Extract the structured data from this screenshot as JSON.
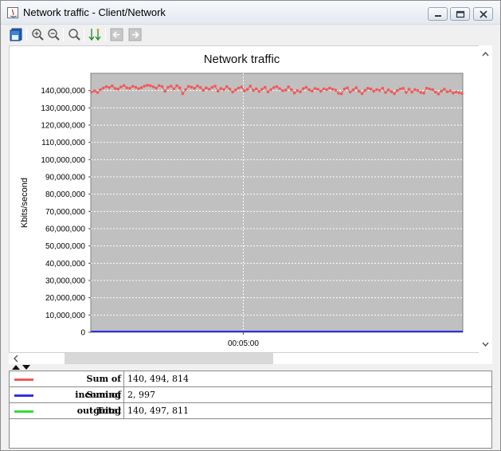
{
  "window": {
    "title": "Network traffic - Client/Network",
    "buttons": [
      "minimize",
      "maximize",
      "close"
    ]
  },
  "toolbar": {
    "items": [
      "save-icon",
      "zoom-in-icon",
      "zoom-out-icon",
      "zoom-fit-icon",
      "sort-down-icon",
      "back-icon",
      "forward-icon"
    ]
  },
  "chart_data": {
    "type": "scatter",
    "title": "Network traffic",
    "xlabel": "",
    "ylabel": "Kbits/second",
    "xticks": [
      "00:05:00"
    ],
    "yticks": [
      "0",
      "10,000,000",
      "20,000,000",
      "30,000,000",
      "40,000,000",
      "50,000,000",
      "60,000,000",
      "70,000,000",
      "80,000,000",
      "90,000,000",
      "100,000,000",
      "110,000,000",
      "120,000,000",
      "130,000,000",
      "140,000,000"
    ],
    "ylim": [
      0,
      150000000
    ],
    "grid": true,
    "colors": {
      "incoming": "#f05a5a",
      "outgoing": "#3030e0",
      "total": "#33dd33",
      "plot_bg": "#c0c0c0"
    },
    "series": [
      {
        "name": "Sum of incoming",
        "values": [
          139200000,
          139800000,
          138900000,
          140600000,
          141500000,
          142300000,
          141800000,
          142700000,
          141200000,
          140900000,
          142100000,
          142900000,
          141600000,
          141300000,
          142500000,
          141900000,
          141100000,
          141700000,
          142600000,
          143100000,
          142800000,
          142200000,
          141400000,
          142900000,
          142300000,
          139600000,
          141900000,
          142600000,
          141000000,
          142800000,
          141600000,
          138200000,
          140600000,
          142400000,
          142000000,
          141300000,
          142700000,
          141800000,
          140200000,
          141600000,
          140800000,
          141900000,
          142600000,
          139700000,
          141200000,
          140600000,
          142300000,
          140900000,
          139200000,
          140400000,
          141500000,
          142100000,
          139800000,
          140700000,
          142600000,
          140100000,
          141000000,
          139500000,
          140800000,
          141900000,
          139200000,
          140600000,
          141800000,
          142300000,
          141100000,
          139900000,
          140300000,
          142200000,
          140500000,
          138600000,
          140000000,
          139300000,
          141100000,
          141900000,
          140500000,
          139700000,
          141200000,
          140800000,
          139600000,
          141000000,
          140600000,
          141500000,
          140800000,
          140300000,
          138400000,
          138100000,
          140900000,
          141600000,
          139200000,
          140400000,
          141700000,
          139600000,
          138200000,
          140100000,
          141300000,
          140900000,
          139600000,
          140600000,
          140100000,
          141400000,
          138900000,
          140400000,
          139400000,
          138200000,
          140000000,
          140900000,
          141300000,
          138900000,
          140800000,
          139200000,
          140600000,
          140000000,
          138900000,
          138500000,
          141400000,
          140900000,
          140600000,
          139100000,
          138000000,
          139700000,
          140800000,
          139300000,
          139900000,
          138600000,
          139200000,
          138800000,
          138300000
        ]
      },
      {
        "name": "Sum of outgoing",
        "values": [
          2997,
          2997
        ]
      }
    ]
  },
  "legend_table": {
    "rows": [
      {
        "name": "Sum of incoming",
        "value": "140, 494, 814",
        "color": "#f05a5a"
      },
      {
        "name": "Sum of outgoing",
        "value": "2, 997",
        "color": "#3030e0"
      },
      {
        "name": "Total",
        "value": "140, 497, 811",
        "color": "#33dd33"
      }
    ]
  }
}
